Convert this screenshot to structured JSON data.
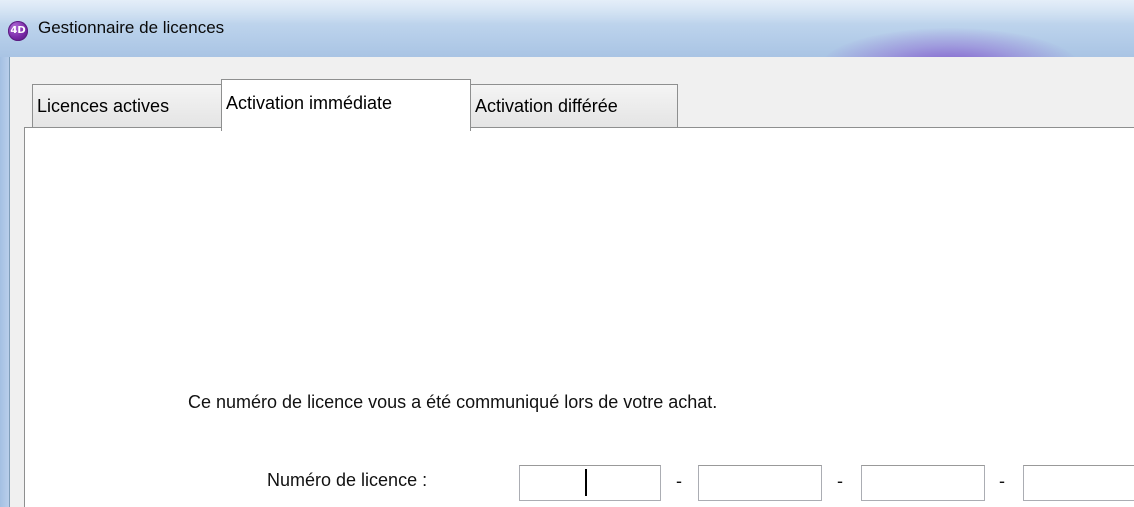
{
  "window": {
    "title": "Gestionnaire de licences",
    "app_icon": "4D"
  },
  "tabs": [
    {
      "label": "Licences actives",
      "active": false
    },
    {
      "label": "Activation immédiate",
      "active": true
    },
    {
      "label": "Activation différée",
      "active": false
    }
  ],
  "panel": {
    "info_text": "Ce numéro de licence vous a été communiqué lors de votre achat.",
    "license_label": "Numéro de licence :",
    "separator": "-",
    "fields": [
      {
        "value": ""
      },
      {
        "value": ""
      },
      {
        "value": ""
      },
      {
        "value": ""
      }
    ]
  },
  "colors": {
    "accent": "#7a2aa8",
    "frame": "#a9c4e4"
  },
  "icons": {
    "app_icon": "4d-logo-icon"
  }
}
